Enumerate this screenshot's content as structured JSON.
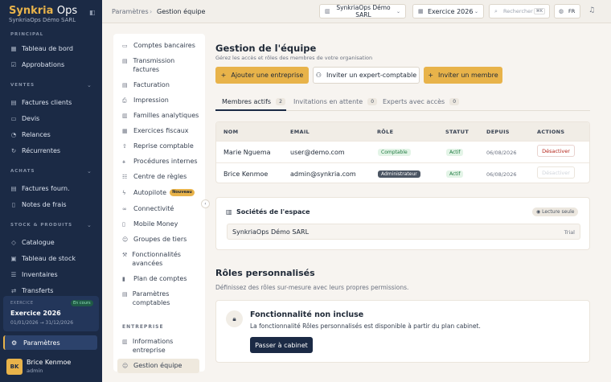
{
  "brand": {
    "name_a": "Synkria",
    "name_b": "Ops",
    "company": "SynkriaOps Démo SARL"
  },
  "sidebar": {
    "sections": {
      "principal": "PRINCIPAL",
      "ventes": "VENTES",
      "achats": "ACHATS",
      "stock": "STOCK & PRODUITS"
    },
    "items": [
      {
        "label": "Tableau de bord",
        "icon": "grid-icon"
      },
      {
        "label": "Approbations",
        "icon": "check-icon"
      },
      {
        "label": "Factures clients",
        "icon": "invoice-icon"
      },
      {
        "label": "Devis",
        "icon": "quote-icon"
      },
      {
        "label": "Relances",
        "icon": "bell-icon"
      },
      {
        "label": "Récurrentes",
        "icon": "repeat-icon"
      },
      {
        "label": "Factures fourn.",
        "icon": "invoice-icon"
      },
      {
        "label": "Notes de frais",
        "icon": "receipt-icon"
      },
      {
        "label": "Catalogue",
        "icon": "tag-icon"
      },
      {
        "label": "Tableau de stock",
        "icon": "box-icon"
      },
      {
        "label": "Inventaires",
        "icon": "list-icon"
      },
      {
        "label": "Transferts",
        "icon": "transfer-icon"
      }
    ],
    "exercise": {
      "label": "EXERCICE",
      "badge": "En cours",
      "title": "Exercice 2026",
      "range": "01/01/2026 → 31/12/2026"
    },
    "settings_label": "Paramètres",
    "user": {
      "initials": "BK",
      "name": "Brice Kenmoe",
      "role": "admin"
    }
  },
  "topbar": {
    "breadcrumb_root": "Paramètres",
    "breadcrumb_current": "Gestion équipe",
    "company_select": "SynkriaOps Démo SARL",
    "fiscal_year": "Exercice 2026",
    "search_placeholder": "Rechercher",
    "search_shortcut": "⌘K",
    "lang": "FR"
  },
  "subnav": {
    "items": [
      "Comptes bancaires",
      "Transmission factures",
      "Facturation",
      "Impression",
      "Familles analytiques",
      "Exercices fiscaux",
      "Reprise comptable",
      "Procédures internes",
      "Centre de règles",
      "Autopilote",
      "Connectivité",
      "Mobile Money",
      "Groupes de tiers",
      "Fonctionnalités avancées",
      "Plan de comptes",
      "Paramètres comptables"
    ],
    "autopilot_badge": "Nouveau",
    "section_entreprise": "ENTREPRISE",
    "entreprise_items": [
      "Informations entreprise",
      "Gestion équipe"
    ]
  },
  "main": {
    "title": "Gestion de l'équipe",
    "subtitle": "Gérez les accès et rôles des membres de votre organisation",
    "buttons": {
      "add_company": "Ajouter une entreprise",
      "invite_expert": "Inviter un expert-comptable",
      "invite_member": "Inviter un membre"
    },
    "tabs": [
      {
        "label": "Membres actifs",
        "count": "2"
      },
      {
        "label": "Invitations en attente",
        "count": "0"
      },
      {
        "label": "Experts avec accès",
        "count": "0"
      }
    ],
    "table": {
      "headers": [
        "NOM",
        "EMAIL",
        "RÔLE",
        "STATUT",
        "DEPUIS",
        "ACTIONS"
      ],
      "rows": [
        {
          "name": "Marie Nguema",
          "email": "user@demo.com",
          "role": "Comptable",
          "status": "Actif",
          "since": "06/08/2026",
          "action": "Désactiver"
        },
        {
          "name": "Brice Kenmoe",
          "email": "admin@synkria.com",
          "role": "Administrateur",
          "status": "Actif",
          "since": "06/08/2026",
          "action": "Désactiver"
        }
      ]
    },
    "companies": {
      "title": "Sociétés de l'espace",
      "badge": "Lecture seule",
      "name": "SynkriaOps Démo SARL",
      "plan": "Trial"
    },
    "roles": {
      "title": "Rôles personnalisés",
      "subtitle": "Définissez des rôles sur-mesure avec leurs propres permissions.",
      "feature_title": "Fonctionnalité non incluse",
      "feature_desc": "La fonctionnalité Rôles personnalisés est disponible à partir du plan cabinet.",
      "upgrade_button": "Passer à cabinet"
    }
  },
  "colors": {
    "sidebar": "#1b2a45",
    "accent": "#e8b34a",
    "background": "#f7f4f0"
  }
}
